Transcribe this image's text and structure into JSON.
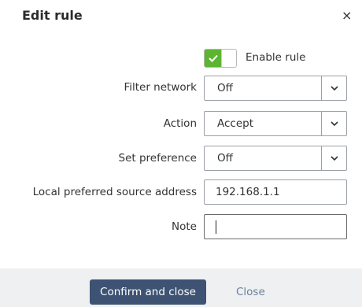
{
  "dialog": {
    "title": "Edit rule",
    "close_symbol": "×",
    "close_icon": "close-icon"
  },
  "form": {
    "enable_rule": {
      "label": "Enable rule",
      "checked": true,
      "accent": "#5cb531"
    },
    "filter_network": {
      "label": "Filter network",
      "value": "Off"
    },
    "action": {
      "label": "Action",
      "value": "Accept"
    },
    "set_preference": {
      "label": "Set preference",
      "value": "Off"
    },
    "local_source": {
      "label": "Local preferred source address",
      "value": "192.168.1.1"
    },
    "note": {
      "label": "Note",
      "value": ""
    }
  },
  "footer": {
    "confirm_label": "Confirm and close",
    "close_label": "Close",
    "primary_color": "#3e5373"
  }
}
